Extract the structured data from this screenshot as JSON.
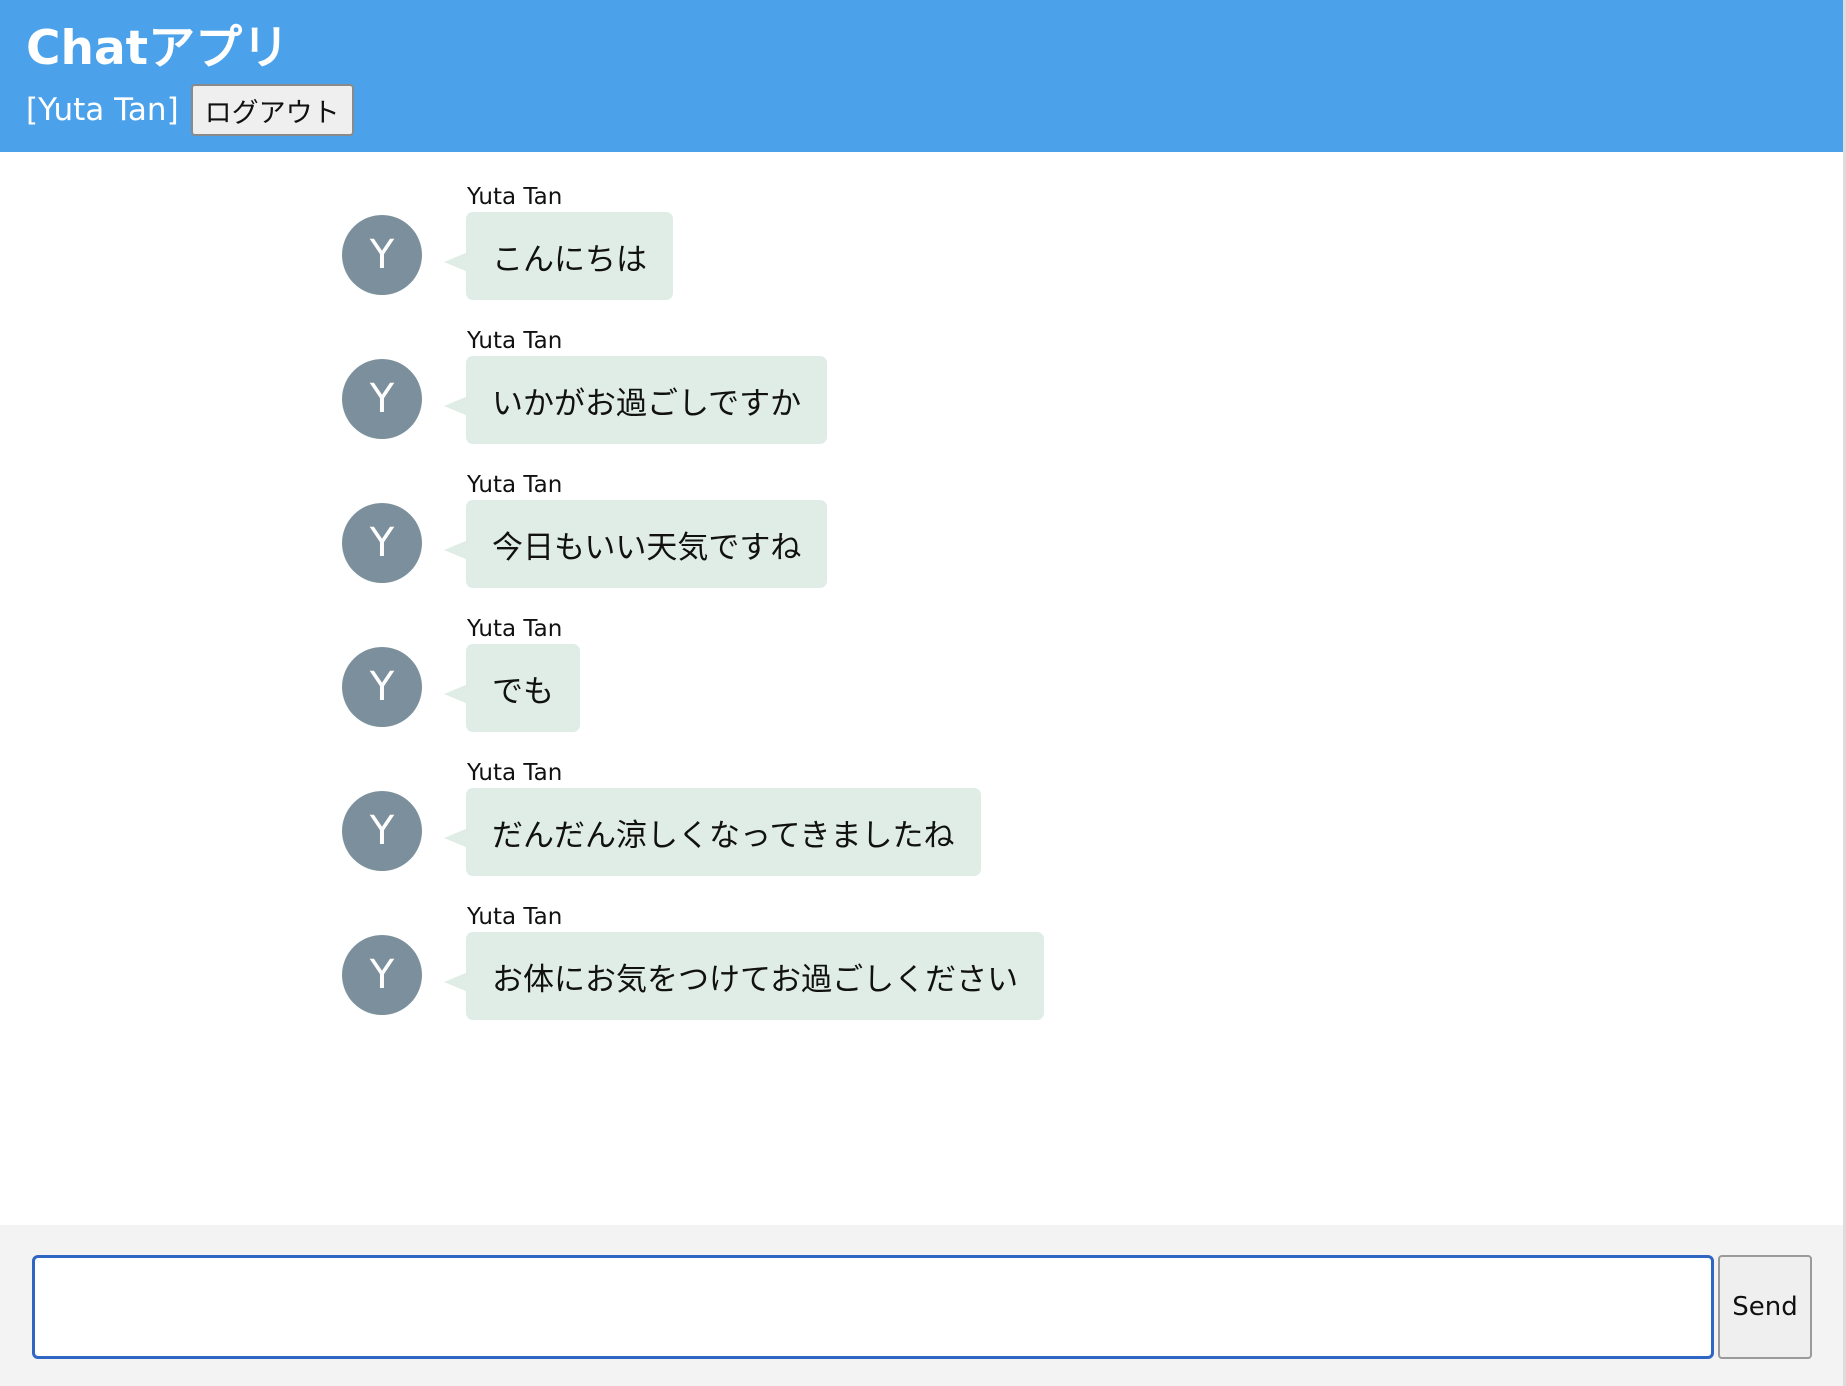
{
  "header": {
    "title": "Chatアプリ",
    "user_label": "[Yuta Tan]",
    "logout_label": "ログアウト",
    "background_color": "#4ba2ea"
  },
  "messages": [
    {
      "sender": "Yuta Tan",
      "avatar_initial": "Y",
      "text": "こんにちは"
    },
    {
      "sender": "Yuta Tan",
      "avatar_initial": "Y",
      "text": "いかがお過ごしですか"
    },
    {
      "sender": "Yuta Tan",
      "avatar_initial": "Y",
      "text": "今日もいい天気ですね"
    },
    {
      "sender": "Yuta Tan",
      "avatar_initial": "Y",
      "text": "でも"
    },
    {
      "sender": "Yuta Tan",
      "avatar_initial": "Y",
      "text": "だんだん涼しくなってきましたね"
    },
    {
      "sender": "Yuta Tan",
      "avatar_initial": "Y",
      "text": "お体にお気をつけてお過ごしください"
    }
  ],
  "composer": {
    "input_value": "",
    "input_placeholder": "",
    "send_label": "Send"
  },
  "colors": {
    "avatar": "#7b8f9c",
    "bubble": "#e0ede6",
    "input_border": "#2f66c4"
  }
}
